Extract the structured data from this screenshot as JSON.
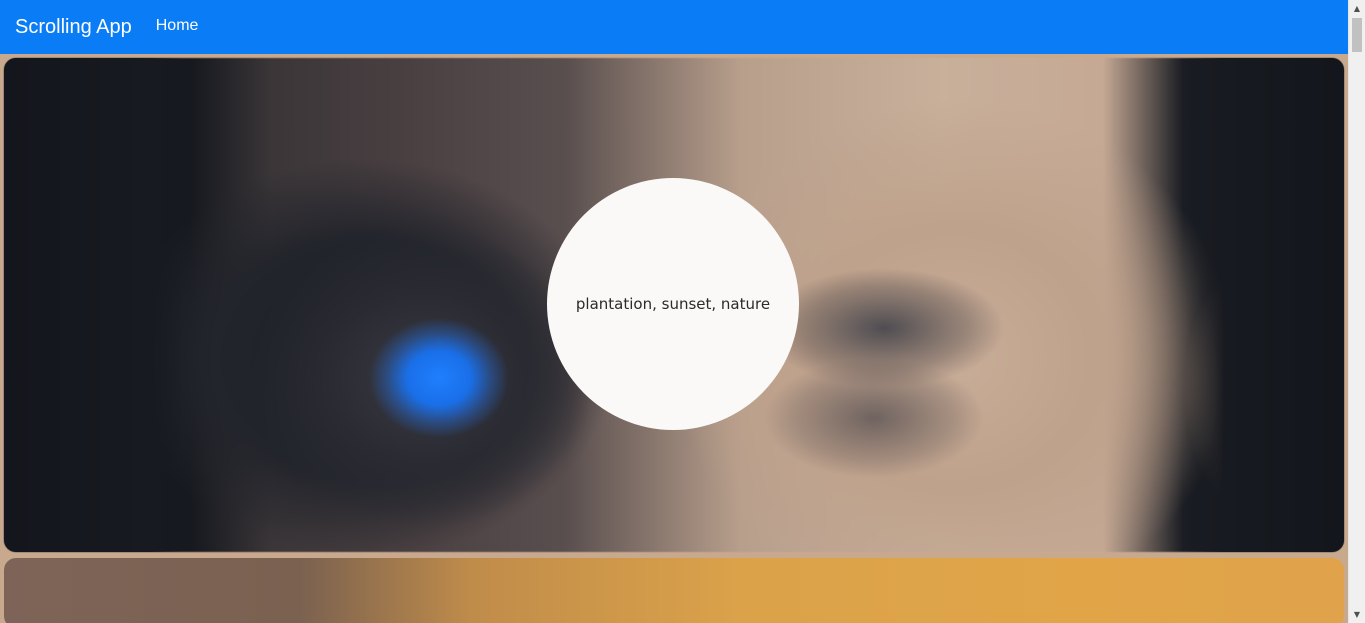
{
  "navbar": {
    "brand": "Scrolling App",
    "links": [
      {
        "label": "Home"
      }
    ],
    "background": "#0a7cf6"
  },
  "hero": {
    "caption": "plantation, sunset, nature"
  },
  "scrollbar": {
    "up_icon": "scroll-up-arrow",
    "down_icon": "scroll-down-arrow",
    "up_glyph": "▲",
    "down_glyph": "▼"
  }
}
